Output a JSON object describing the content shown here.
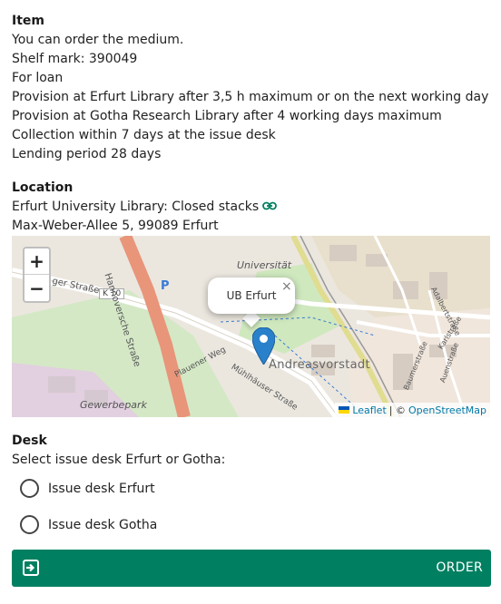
{
  "item": {
    "title": "Item",
    "lines": [
      "You can order the medium.",
      "Shelf mark: 390049",
      "For loan",
      "Provision at Erfurt Library after 3,5 h maximum or on the next working day",
      "Provision at Gotha Research Library after 4 working days maximum",
      "Collection within 7 days at the issue desk",
      "Lending period 28 days"
    ]
  },
  "location": {
    "title": "Location",
    "library": "Erfurt University Library: Closed stacks",
    "address": "Max-Weber-Allee 5, 99089 Erfurt"
  },
  "map": {
    "zoom_in": "+",
    "zoom_out": "−",
    "popup_label": "UB Erfurt",
    "popup_close": "×",
    "attribution_leaflet": "Leaflet",
    "attribution_sep": "| ©",
    "attribution_osm": "OpenStreetMap",
    "labels": {
      "universitat": "Universität",
      "strasse_left": "ger Straße",
      "k10": "K 10",
      "hannoversche": "Hannoversche Straße",
      "parking": "P",
      "andreasvorstadt": "Andreasvorstadt",
      "plauener": "Plauener Weg",
      "muhlhauser": "Mühlhäuser Straße",
      "gewerbepark": "Gewerbepark",
      "baumerstrasse": "Baumerstraße",
      "auenstrasse": "Auenstraße",
      "karlstrasse": "Karlstraße",
      "adalbertstrasse": "Adalbertstraße"
    },
    "colors": {
      "main_road": "#f0a58a",
      "road": "#ffffff",
      "green": "#cfe8be",
      "building": "#d9d0c9",
      "water": "#aad3df",
      "marker": "#2a81cb"
    }
  },
  "desk": {
    "title": "Desk",
    "prompt": "Select issue desk Erfurt or Gotha:",
    "options": [
      "Issue desk Erfurt",
      "Issue desk Gotha"
    ]
  },
  "order": {
    "label": "ORDER",
    "color": "#008061"
  }
}
